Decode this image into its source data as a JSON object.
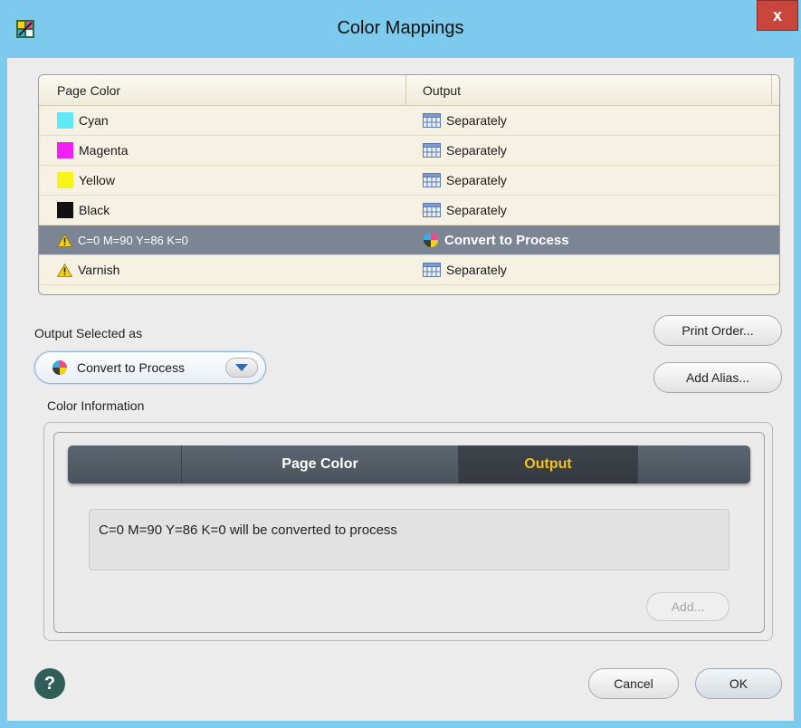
{
  "window": {
    "title": "Color Mappings",
    "close_label": "x",
    "app_icon": "app-icon",
    "close_icon": "close-icon"
  },
  "table": {
    "headers": [
      "Page Color",
      "Output"
    ],
    "rows": [
      {
        "color_name": "Cyan",
        "swatch": "#5fe8f5",
        "output": "Separately",
        "output_icon": "separation-grid-icon",
        "warning": false,
        "selected": false
      },
      {
        "color_name": "Magenta",
        "swatch": "#f21ef5",
        "output": "Separately",
        "output_icon": "separation-grid-icon",
        "warning": false,
        "selected": false
      },
      {
        "color_name": "Yellow",
        "swatch": "#f5f51a",
        "output": "Separately",
        "output_icon": "separation-grid-icon",
        "warning": false,
        "selected": false
      },
      {
        "color_name": "Black",
        "swatch": "#111111",
        "output": "Separately",
        "output_icon": "separation-grid-icon",
        "warning": false,
        "selected": false
      },
      {
        "color_name": "C=0 M=90 Y=86 K=0",
        "swatch": "",
        "output": "Convert to Process",
        "output_icon": "process-color-icon",
        "warning": true,
        "selected": true
      },
      {
        "color_name": "Varnish",
        "swatch": "",
        "output": "Separately",
        "output_icon": "separation-grid-icon",
        "warning": true,
        "selected": false
      }
    ]
  },
  "output_selected": {
    "label": "Output Selected as",
    "value": "Convert to Process",
    "icon": "process-color-icon"
  },
  "buttons": {
    "print_order": "Print Order...",
    "add_alias": "Add Alias...",
    "add": "Add...",
    "cancel": "Cancel",
    "ok": "OK",
    "help": "?"
  },
  "color_information": {
    "label": "Color Information",
    "tabs": [
      "Page Color",
      "Output"
    ],
    "active_tab": "Output",
    "message": "C=0 M=90 Y=86 K=0 will be converted to process"
  },
  "colors": {
    "titlebar": "#7ccbee",
    "selected_row": "#7c8593",
    "active_tab_text": "#f2c21b",
    "help_button": "#2f5f58"
  }
}
